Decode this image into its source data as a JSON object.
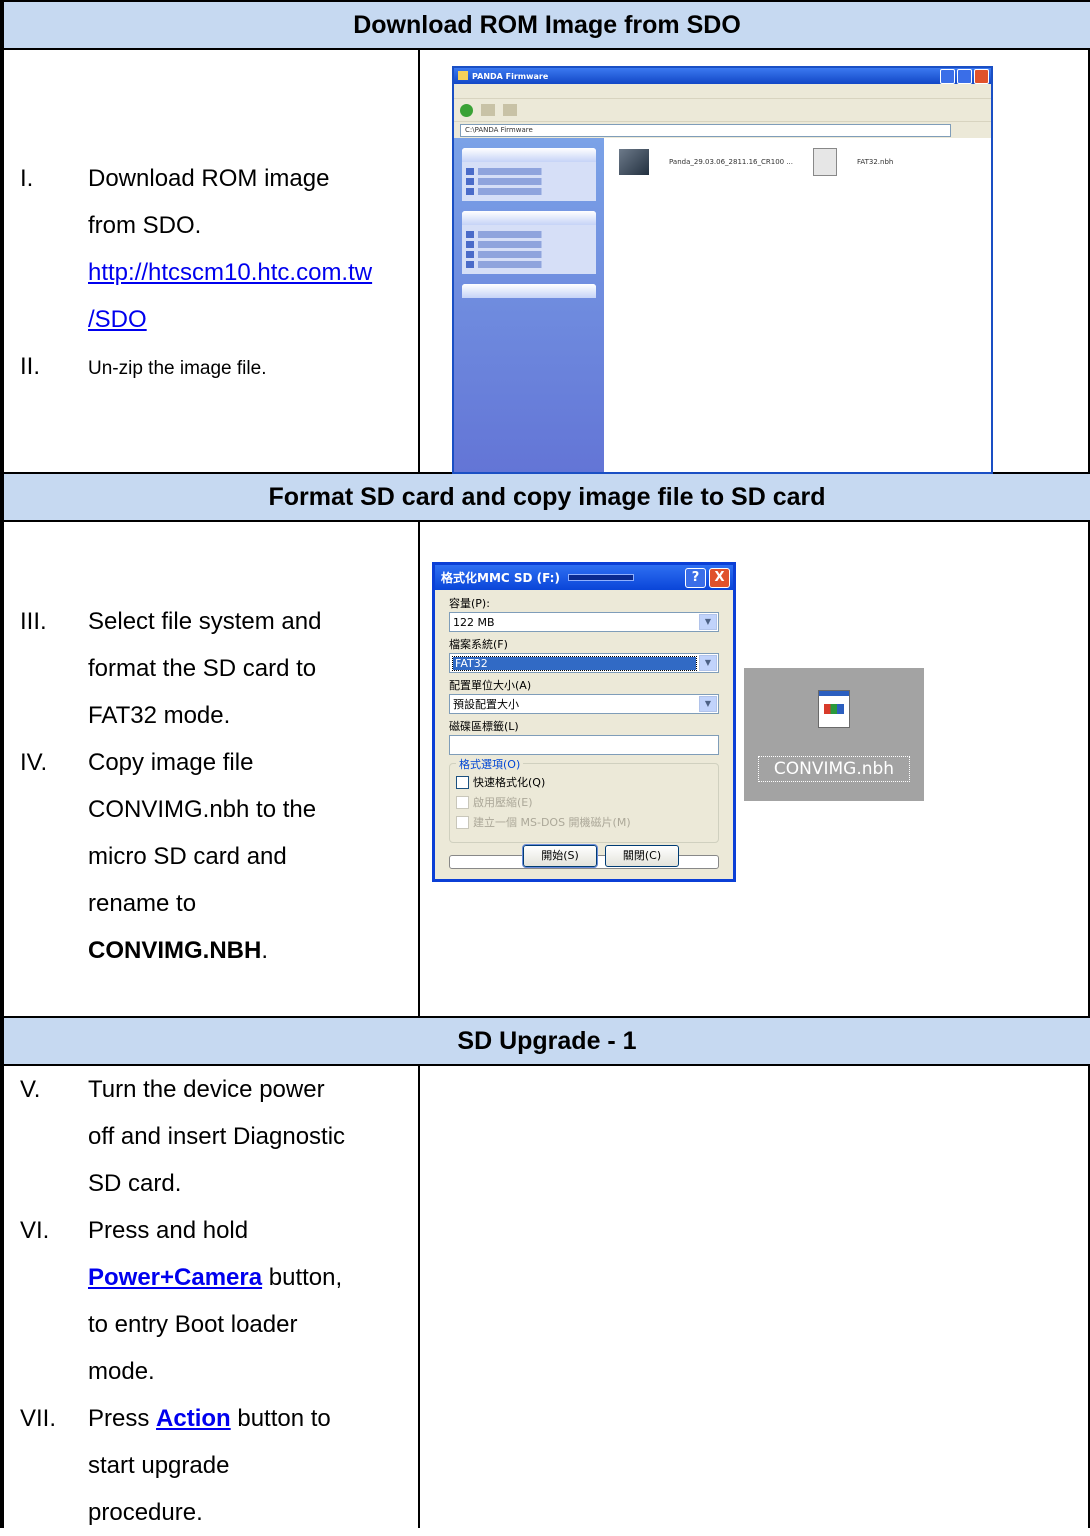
{
  "sections": [
    {
      "title": "Download ROM Image from SDO",
      "steps": [
        {
          "num": "I.",
          "text1": "Download ROM image",
          "text2": "from SDO.",
          "link1": "http://htcscm10.htc.com.tw",
          "link2": "/SDO"
        },
        {
          "num": "II.",
          "text": "Un-zip the image file."
        }
      ]
    },
    {
      "title": "Format SD card and copy image file to SD card",
      "steps": [
        {
          "num": "III.",
          "lines": [
            "Select file system and",
            "format the SD card to",
            "FAT32 mode."
          ]
        },
        {
          "num": "IV.",
          "lines": [
            "Copy image file",
            "CONVIMG.nbh to the",
            "micro SD card and",
            "rename to"
          ],
          "bold_line": "CONVIMG.NBH",
          "tail": "."
        }
      ]
    },
    {
      "title": "SD Upgrade - 1",
      "steps": [
        {
          "num": "V.",
          "lines": [
            "Turn the device power",
            "off and insert Diagnostic",
            "SD card."
          ]
        },
        {
          "num": "VI.",
          "pre": "Press and hold",
          "key": "Power+Camera",
          "post": " button,",
          "lines": [
            "to entry Boot loader",
            "mode."
          ]
        },
        {
          "num": "VII.",
          "pre": "Press ",
          "key": "Action",
          "post": " button to",
          "lines": [
            "start upgrade",
            "procedure."
          ]
        }
      ]
    }
  ],
  "format_dialog": {
    "title": "格式化MMC   SD (F:)",
    "help": "?",
    "close": "X",
    "capacity_label": "容量(P):",
    "capacity_value": "122 MB",
    "fs_label": "檔案系統(F)",
    "fs_value": "FAT32",
    "alloc_label": "配置單位大小(A)",
    "alloc_value": "預設配置大小",
    "volume_label": "磁碟區標籤(L)",
    "options_label": "格式選項(O)",
    "opt_quick": "快速格式化(Q)",
    "opt_compress": "啟用壓縮(E)",
    "opt_bootdisk": "建立一個 MS-DOS 開機磁片(M)",
    "start_btn": "開始(S)",
    "close_btn": "關閉(C)"
  },
  "explorer": {
    "title": "PANDA Firmware",
    "address": "C:\\PANDA Firmware",
    "file1": "Panda_29.03.06_2811.16_CR100 ...",
    "file2": "FAT32.nbh"
  },
  "file_icon": {
    "name": "CONVIMG.nbh",
    "icon": "document-icon"
  },
  "colors": {
    "header_bg": "#c6d9f1",
    "link": "#0000ee"
  }
}
